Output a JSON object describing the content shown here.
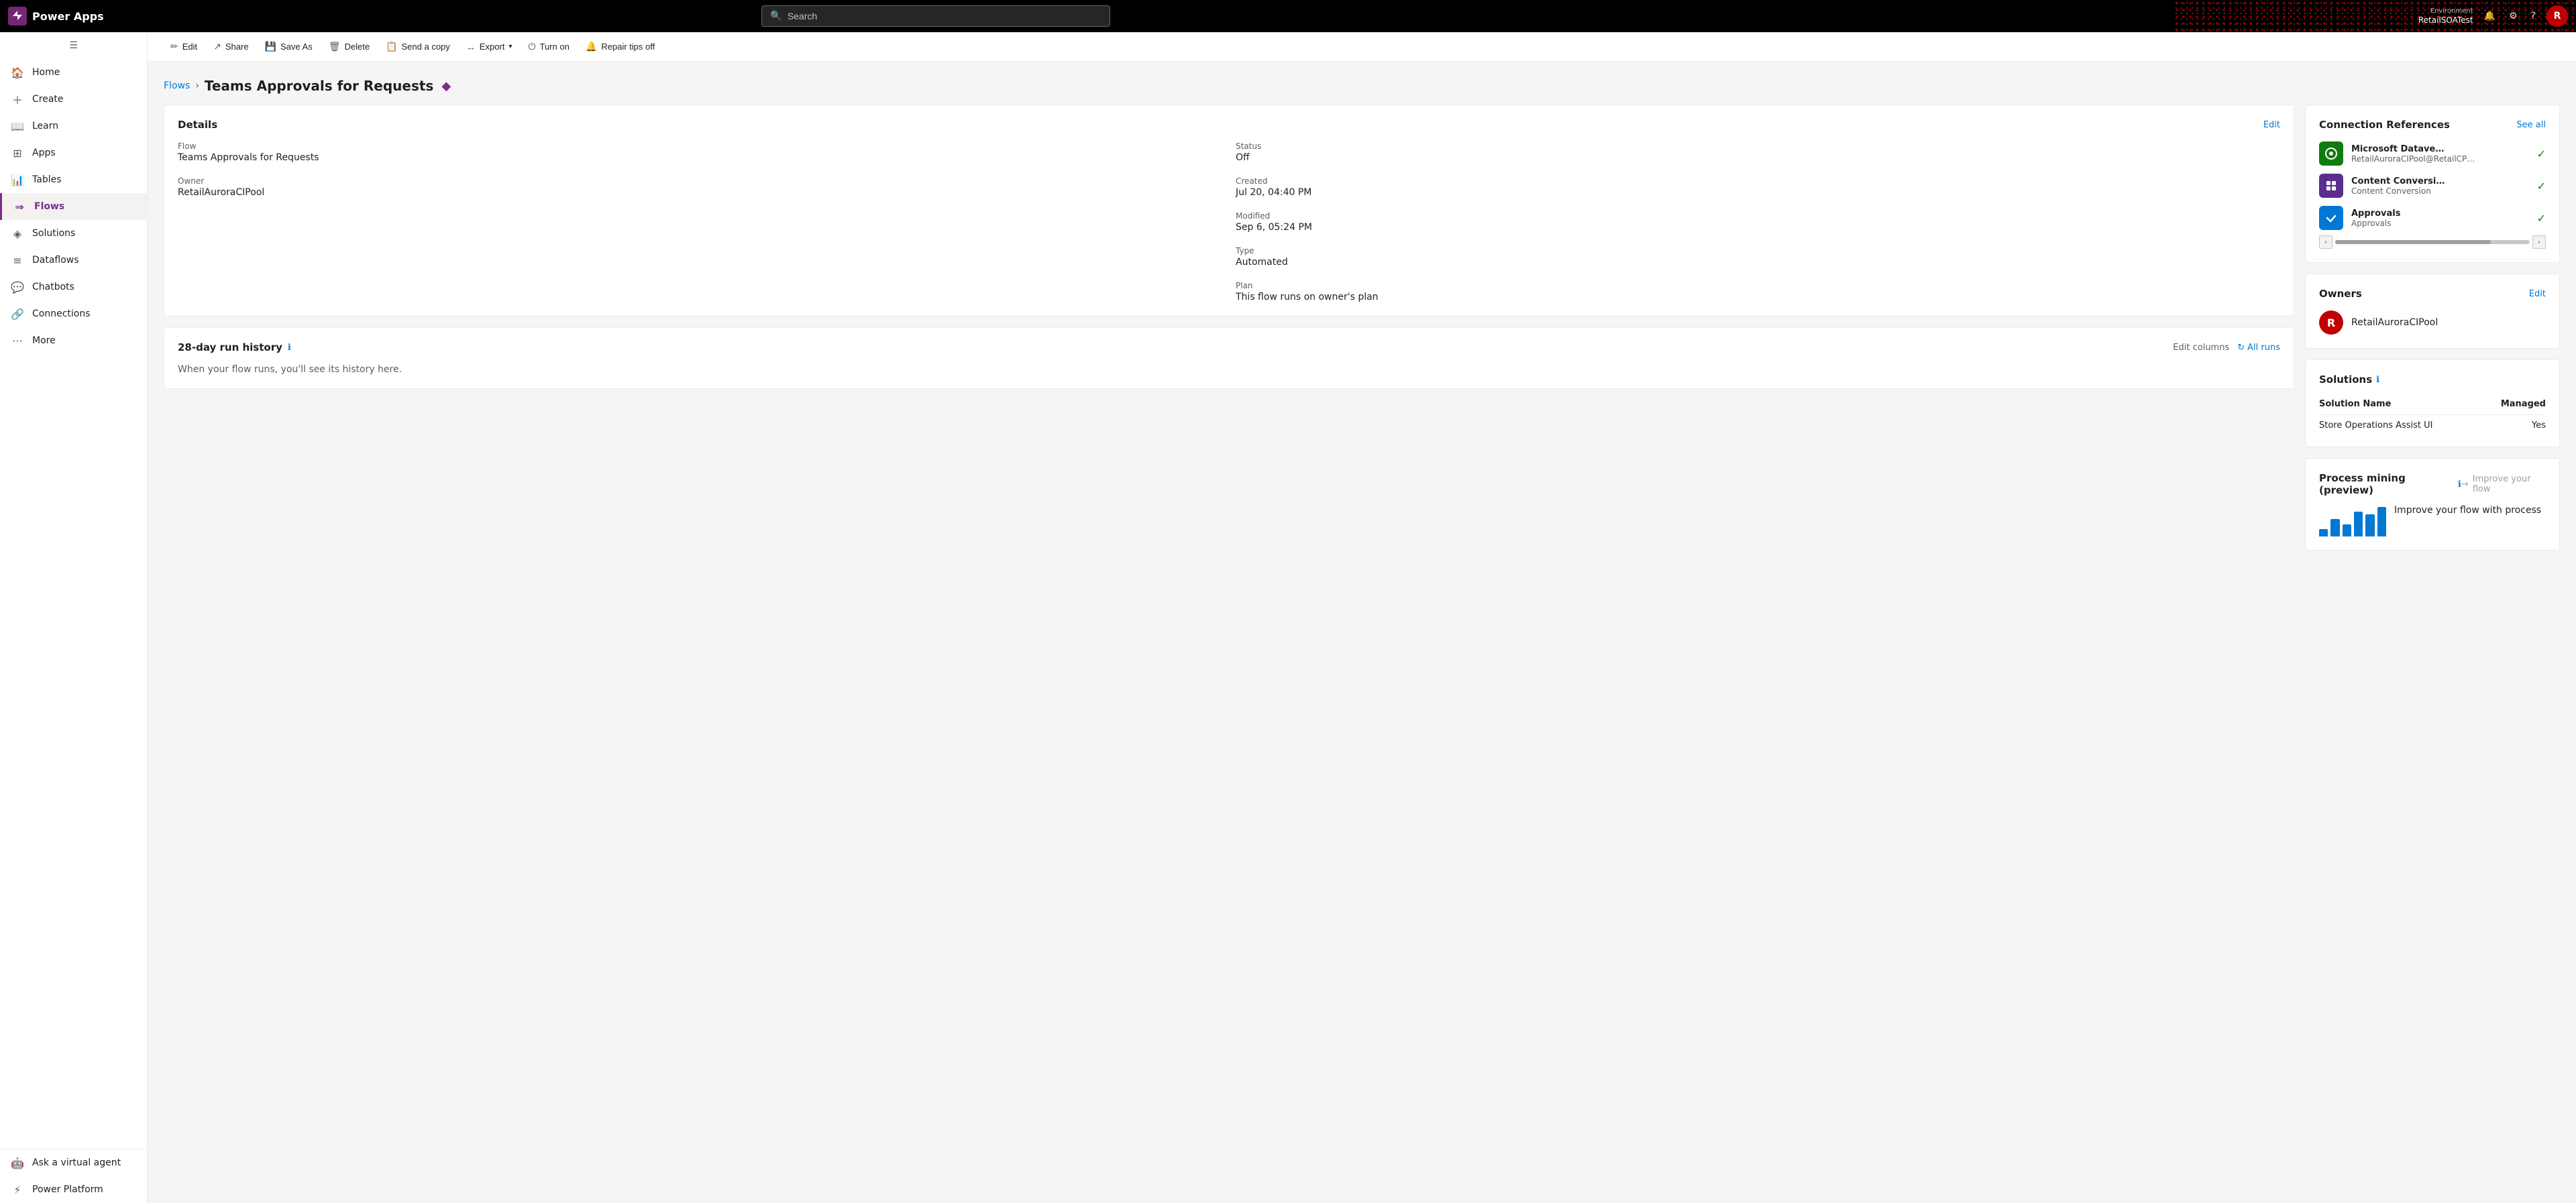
{
  "topbar": {
    "logo_text": "Power Apps",
    "search_placeholder": "Search",
    "env_label": "Environment",
    "env_name": "RetailSOATest",
    "avatar_letter": "R"
  },
  "sidebar": {
    "collapse_title": "Collapse",
    "items": [
      {
        "id": "home",
        "label": "Home",
        "icon": "⊙"
      },
      {
        "id": "create",
        "label": "Create",
        "icon": "+"
      },
      {
        "id": "learn",
        "label": "Learn",
        "icon": "□"
      },
      {
        "id": "apps",
        "label": "Apps",
        "icon": "⊞"
      },
      {
        "id": "tables",
        "label": "Tables",
        "icon": "☰"
      },
      {
        "id": "flows",
        "label": "Flows",
        "icon": "⇒",
        "active": true
      },
      {
        "id": "solutions",
        "label": "Solutions",
        "icon": "◈"
      },
      {
        "id": "dataflows",
        "label": "Dataflows",
        "icon": "≡"
      },
      {
        "id": "chatbots",
        "label": "Chatbots",
        "icon": "⊡"
      },
      {
        "id": "connections",
        "label": "Connections",
        "icon": "⟳"
      },
      {
        "id": "more",
        "label": "More",
        "icon": "…"
      }
    ],
    "bottom_items": [
      {
        "id": "ask-virtual-agent",
        "label": "Ask a virtual agent",
        "icon": "?"
      },
      {
        "id": "power-platform",
        "label": "Power Platform",
        "icon": "⚡"
      }
    ]
  },
  "command_bar": {
    "buttons": [
      {
        "id": "edit",
        "label": "Edit",
        "icon": "✏"
      },
      {
        "id": "share",
        "label": "Share",
        "icon": "↗"
      },
      {
        "id": "save-as",
        "label": "Save As",
        "icon": "💾"
      },
      {
        "id": "delete",
        "label": "Delete",
        "icon": "🗑"
      },
      {
        "id": "send-copy",
        "label": "Send a copy",
        "icon": "📋"
      },
      {
        "id": "export",
        "label": "Export",
        "icon": "↔",
        "has_dropdown": true
      },
      {
        "id": "turn-on",
        "label": "Turn on",
        "icon": "⏻"
      },
      {
        "id": "repair-tips-off",
        "label": "Repair tips off",
        "icon": "🔔"
      }
    ]
  },
  "breadcrumb": {
    "parent_label": "Flows",
    "current_label": "Teams Approvals for Requests",
    "badge": "◆"
  },
  "details_card": {
    "title": "Details",
    "edit_label": "Edit",
    "flow_label": "Flow",
    "flow_value": "Teams Approvals for Requests",
    "owner_label": "Owner",
    "owner_value": "RetailAuroraCIPool",
    "status_label": "Status",
    "status_value": "Off",
    "created_label": "Created",
    "created_value": "Jul 20, 04:40 PM",
    "modified_label": "Modified",
    "modified_value": "Sep 6, 05:24 PM",
    "type_label": "Type",
    "type_value": "Automated",
    "plan_label": "Plan",
    "plan_value": "This flow runs on owner's plan"
  },
  "run_history": {
    "title": "28-day run history",
    "info_icon": "ℹ",
    "edit_columns_label": "Edit columns",
    "all_runs_label": "All runs",
    "empty_message": "When your flow runs, you'll see its history here."
  },
  "connection_references": {
    "title": "Connection References",
    "see_all_label": "See all",
    "items": [
      {
        "id": "dataverse",
        "name": "Microsoft Datave…",
        "sub": "RetailAuroraCIPool@RetailCP…",
        "color": "green",
        "icon_char": "◉",
        "status": "✓"
      },
      {
        "id": "content-conversion",
        "name": "Content Conversi…",
        "sub": "Content Conversion",
        "color": "purple",
        "icon_char": "⊞",
        "status": "✓"
      },
      {
        "id": "approvals",
        "name": "Approvals",
        "sub": "Approvals",
        "color": "blue",
        "icon_char": "✔",
        "status": "✓"
      }
    ]
  },
  "owners_card": {
    "title": "Owners",
    "edit_label": "Edit",
    "avatar_letter": "R",
    "owner_name": "RetailAuroraCIPool"
  },
  "solutions_card": {
    "title": "Solutions",
    "info_icon": "ℹ",
    "col_solution_name": "Solution Name",
    "col_managed": "Managed",
    "rows": [
      {
        "name": "Store Operations Assist UI",
        "managed": "Yes"
      }
    ]
  },
  "process_mining_card": {
    "title": "Process mining (preview)",
    "info_icon": "ℹ",
    "action_label": "Improve your flow",
    "heading": "Improve your flow with process",
    "bars": [
      12,
      28,
      20,
      40,
      36,
      48
    ]
  }
}
